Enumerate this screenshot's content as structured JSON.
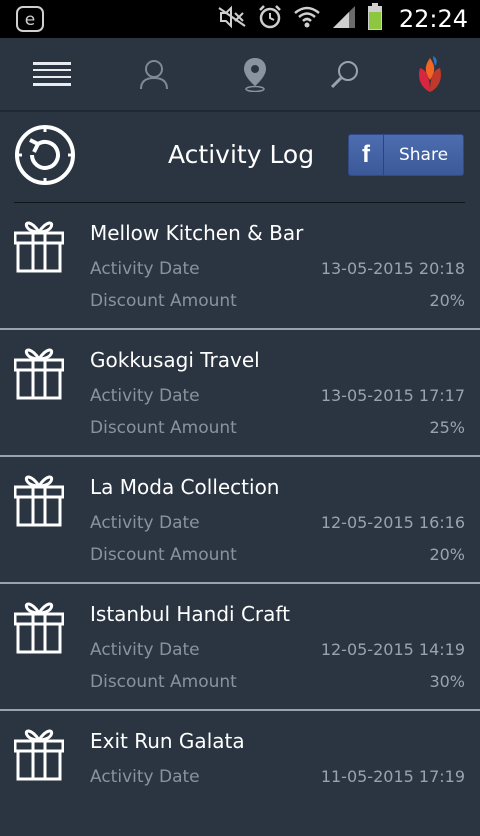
{
  "status_bar": {
    "time": "22:24",
    "icons": [
      "e-notification-icon",
      "mute-icon",
      "alarm-icon",
      "wifi-icon",
      "signal-icon",
      "battery-icon"
    ]
  },
  "toolbar": {
    "icons": [
      "menu-icon",
      "profile-icon",
      "location-icon",
      "search-icon",
      "app-logo-icon"
    ]
  },
  "header": {
    "title": "Activity Log",
    "share_label": "Share",
    "share_icon_letter": "f"
  },
  "activities": [
    {
      "name": "Mellow Kitchen & Bar",
      "date_label": "Activity Date",
      "date": "13-05-2015 20:18",
      "discount_label": "Discount Amount",
      "discount": "20%"
    },
    {
      "name": "Gokkusagi Travel",
      "date_label": "Activity Date",
      "date": "13-05-2015 17:17",
      "discount_label": "Discount Amount",
      "discount": "25%"
    },
    {
      "name": "La Moda Collection",
      "date_label": "Activity Date",
      "date": "12-05-2015 16:16",
      "discount_label": "Discount Amount",
      "discount": "20%"
    },
    {
      "name": "Istanbul Handi Craft",
      "date_label": "Activity Date",
      "date": "12-05-2015 14:19",
      "discount_label": "Discount Amount",
      "discount": "30%"
    },
    {
      "name": "Exit Run Galata",
      "date_label": "Activity Date",
      "date": "11-05-2015 17:19",
      "discount_label": "Discount Amount",
      "discount": ""
    }
  ],
  "colors": {
    "background": "#2b3541",
    "facebook": "#3b5998",
    "logo_orange": "#f26522",
    "logo_red": "#d7263d",
    "logo_blue": "#2a74c9",
    "battery_green": "#8dc63f"
  }
}
